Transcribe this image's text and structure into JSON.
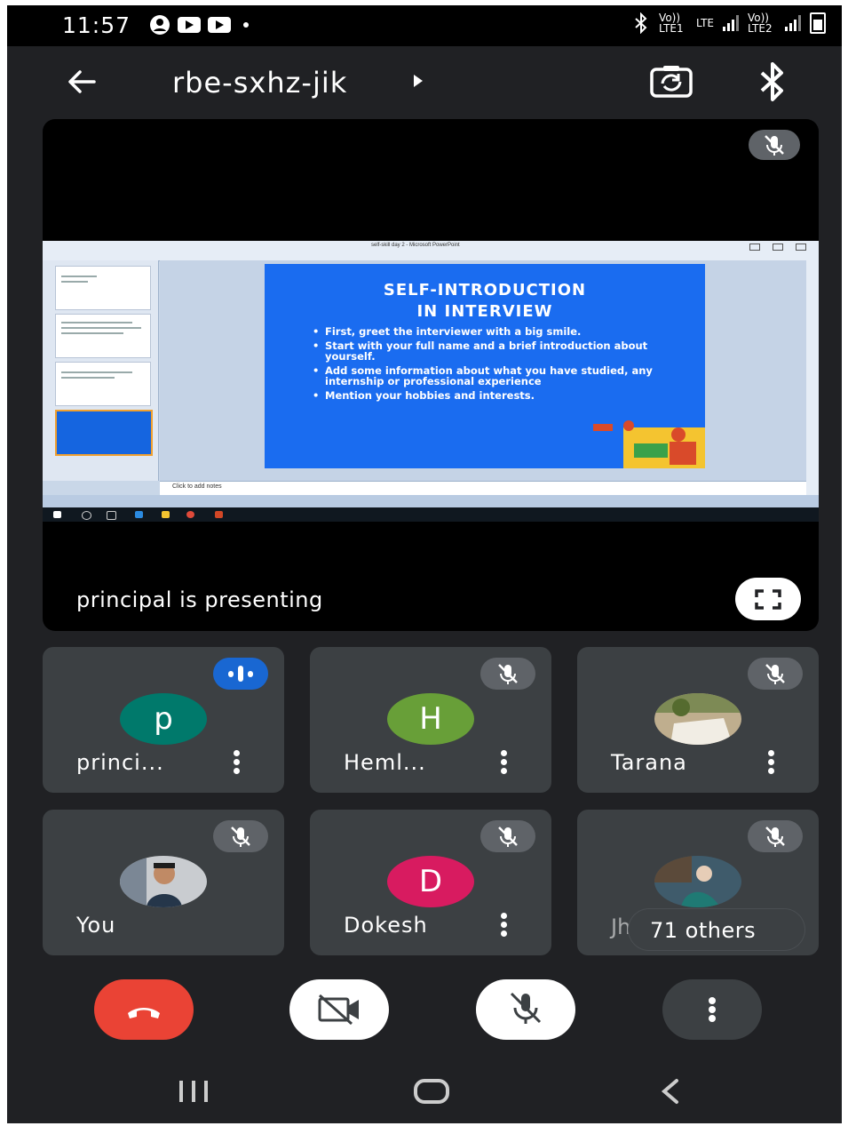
{
  "status_bar": {
    "time": "11:57",
    "left_icons": [
      "account-icon",
      "youtube-icon",
      "youtube-icon",
      "notification-dot-icon"
    ],
    "right_icons": [
      "bluetooth-icon",
      "volte-lte1-icon",
      "lte-data-icon",
      "signal-icon",
      "volte-lte2-icon",
      "signal-icon",
      "battery-icon"
    ],
    "sim1_label": "Vo)) LTE1",
    "data_label": "LTE",
    "sim2_label": "Vo)) LTE2"
  },
  "top_bar": {
    "meeting_code": "rbe-sxhz-jik",
    "back_icon": "arrow-left-icon",
    "switch_camera_icon": "switch-camera-icon",
    "bluetooth_icon": "bluetooth-icon"
  },
  "presentation": {
    "presenter_text": "principal is presenting",
    "window_title": "self-skill day 2 - Microsoft PowerPoint",
    "notes_placeholder": "Click to add notes",
    "slide": {
      "title_line1": "SELF-INTRODUCTION",
      "title_line2": "IN INTERVIEW",
      "bullets": [
        "First, greet the interviewer with a big smile.",
        "Start with your full name and a brief introduction about yourself.",
        "Add some information about what you have studied, any internship or professional experience",
        "Mention your hobbies and interests."
      ]
    },
    "fullscreen_icon": "fullscreen-icon",
    "mute_icon": "mic-off-icon"
  },
  "participants": [
    {
      "name": "princi...",
      "initial": "p",
      "avatar_color": "#00796b",
      "state": "speaking"
    },
    {
      "name": "Heml...",
      "initial": "H",
      "avatar_color": "#689f38",
      "state": "muted"
    },
    {
      "name": "Tarana",
      "initial": "",
      "avatar_color": "#8d8d8d",
      "state": "muted"
    },
    {
      "name": "You",
      "initial": "",
      "avatar_color": "#6b7b8c",
      "state": "muted"
    },
    {
      "name": "Dokesh",
      "initial": "D",
      "avatar_color": "#d81b60",
      "state": "muted"
    },
    {
      "name": "Jh",
      "initial": "",
      "avatar_color": "#3f5b6b",
      "state": "muted"
    }
  ],
  "others": {
    "label": "71 others"
  },
  "controls": {
    "end_call": {
      "icon": "end-call-icon",
      "color": "#ea4335"
    },
    "camera": {
      "icon": "camera-off-icon",
      "color": "#ffffff"
    },
    "microphone": {
      "icon": "mic-off-icon",
      "color": "#ffffff"
    },
    "more": {
      "icon": "more-vert-icon",
      "color": "#3c4043"
    }
  },
  "nav_bar": [
    "recents-icon",
    "home-icon",
    "back-icon"
  ]
}
